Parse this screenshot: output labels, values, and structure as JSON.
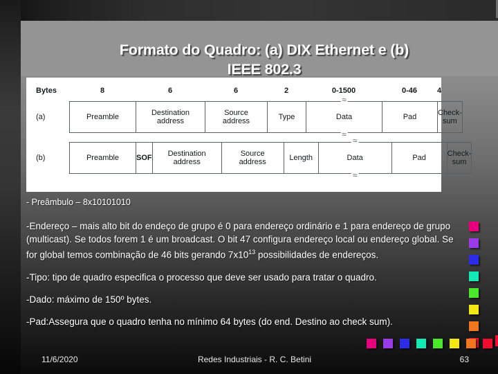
{
  "slide": {
    "title": "Formato do Quadro: (a) DIX Ethernet e (b)\nIEEE 802.3"
  },
  "figure": {
    "bytes_label": "Bytes",
    "row_a_label": "(a)",
    "row_b_label": "(b)",
    "byte_counts": [
      "8",
      "6",
      "6",
      "2",
      "0-1500",
      "0-46",
      "4"
    ],
    "row_a_fields": [
      "Preamble",
      "Destination\naddress",
      "Source\naddress",
      "Type",
      "Data",
      "Pad",
      "Check-\nsum"
    ],
    "row_b_fields": [
      "Preamble",
      "SOF",
      "Destination\naddress",
      "Source\naddress",
      "Length",
      "Data",
      "Pad",
      "Check-\nsum"
    ],
    "sof_letters": [
      "S",
      "O",
      "F"
    ],
    "squiggle": "≈"
  },
  "body": {
    "paragraphs": [
      "- Preâmbulo – 8x10101010",
      "-Endereço – mais alto bit do endeço de grupo é 0 para endereço ordinário e 1 para endereço de grupo (multicast). Se todos forem 1 é um broadcast. O bit 47 configura endereço local ou endereço global. Se for global temos combinação de 46 bits gerando 7x10",
      "-Tipo: tipo de quadro especifica o processo que deve ser usado para tratar o quadro.",
      "-Dado: máximo de 150º bytes.",
      "-Pad:Assegura que o quadro tenha no mínimo 64 bytes (do end. Destino ao check sum)."
    ],
    "exponent": "13",
    "paragraph_2_tail": " possibilidades de endereços."
  },
  "chips": {
    "colors": [
      "#e6007e",
      "#9b3ae8",
      "#2b2be8",
      "#14e8b4",
      "#4ae828",
      "#f2e812",
      "#f2761f",
      "#f20d2e"
    ],
    "vertical_spacing": 24,
    "horizontal_spacing": 24
  },
  "footer": {
    "date": "11/6/2020",
    "center": "Redes Industriais - R. C. Betini",
    "page": "63"
  }
}
